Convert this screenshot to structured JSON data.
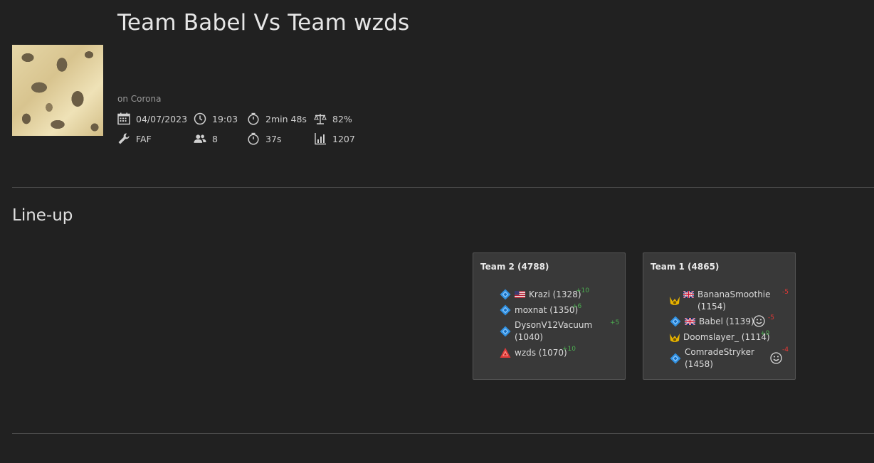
{
  "header": {
    "title": "Team Babel Vs Team wzds",
    "map_label": "on Corona"
  },
  "meta": {
    "date": "04/07/2023",
    "time": "19:03",
    "duration": "2min 48s",
    "balance": "82%",
    "featured_mod": "FAF",
    "players": "8",
    "time_to_first": "37s",
    "avg_rating": "1207"
  },
  "lineup": {
    "section_title": "Line-up",
    "teams": [
      {
        "title": "Team 2 (4788)",
        "players": [
          {
            "name": "Krazi (1328)",
            "delta": "+10",
            "faction": "aeon",
            "flag": "us"
          },
          {
            "name": "moxnat (1350)",
            "delta": "+6",
            "faction": "aeon"
          },
          {
            "name_line1": "DysonV12Vacuum",
            "name_line2": "(1040)",
            "delta": "+5",
            "faction": "aeon"
          },
          {
            "name": "wzds (1070)",
            "delta": "+10",
            "faction": "cybran"
          }
        ]
      },
      {
        "title": "Team 1 (4865)",
        "players": [
          {
            "name_line1": "BananaSmoothie",
            "name_line2": "(1154)",
            "delta": "-5",
            "faction": "seraphim",
            "flag": "gb"
          },
          {
            "name": "Babel (1139)",
            "delta": "-5",
            "faction": "aeon",
            "flag": "gb",
            "icon": "smiley"
          },
          {
            "name": "Doomslayer_ (1114)",
            "delta": "+0",
            "faction": "seraphim"
          },
          {
            "name_line1": "ComradeStryker",
            "name_line2": "(1458)",
            "delta": "-4",
            "faction": "aeon",
            "icon": "smiley"
          }
        ]
      }
    ]
  },
  "colors": {
    "background": "#212121",
    "panel": "#393939",
    "positive": "#4caf50",
    "negative": "#e53935",
    "aeon": "#2e8fe0",
    "cybran": "#e03a3a",
    "seraphim": "#e8b400"
  }
}
